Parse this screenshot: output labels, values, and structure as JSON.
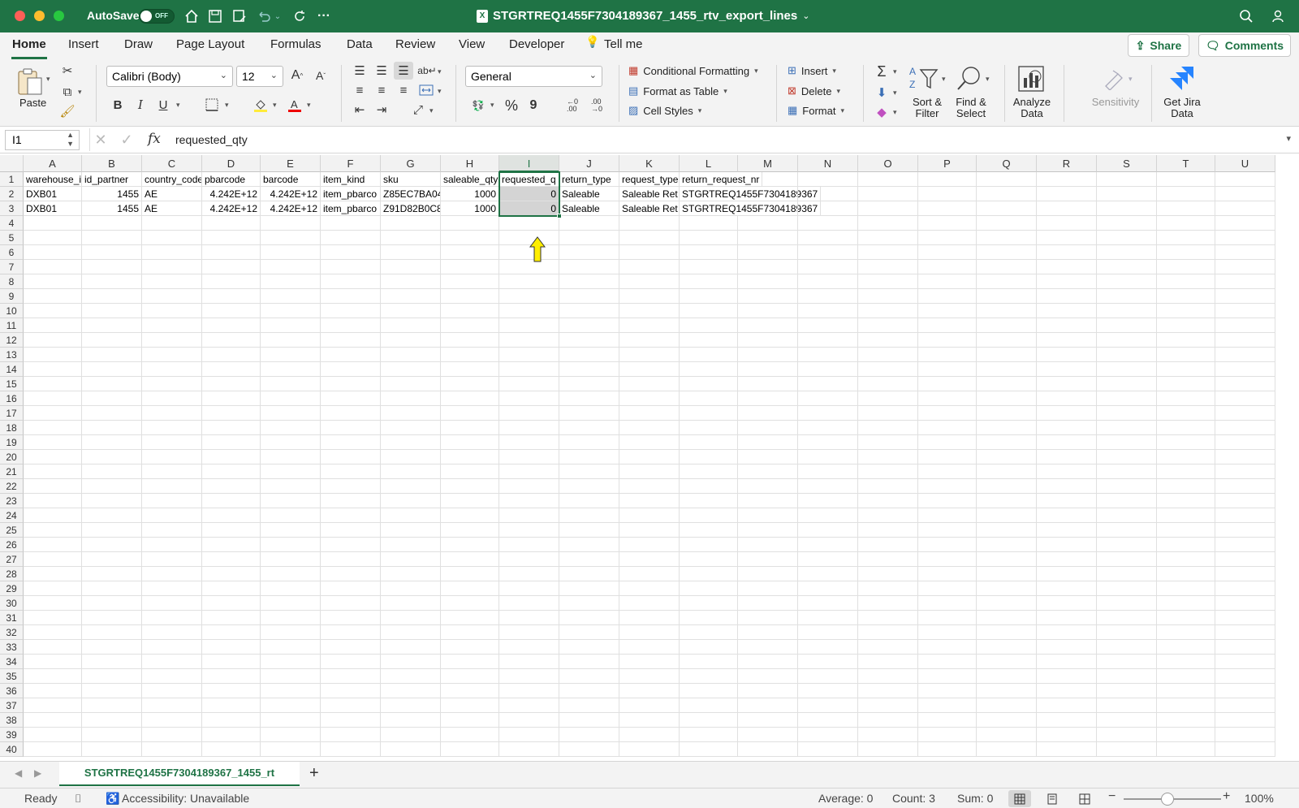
{
  "window": {
    "autosave_label": "AutoSave",
    "autosave_state": "OFF",
    "title": "STGRTREQ1455F7304189367_1455_rtv_export_lines"
  },
  "tabs": [
    "Home",
    "Insert",
    "Draw",
    "Page Layout",
    "Formulas",
    "Data",
    "Review",
    "View",
    "Developer",
    "Tell me"
  ],
  "share_label": "Share",
  "comments_label": "Comments",
  "ribbon": {
    "paste": "Paste",
    "font_name": "Calibri (Body)",
    "font_size": "12",
    "bold": "B",
    "italic": "I",
    "underline": "U",
    "number_format": "General",
    "percent": "%",
    "comma": "9",
    "conditional_formatting": "Conditional Formatting",
    "format_as_table": "Format as Table",
    "cell_styles": "Cell Styles",
    "insert": "Insert",
    "delete": "Delete",
    "format": "Format",
    "sort_filter_1": "Sort &",
    "sort_filter_2": "Filter",
    "find_select_1": "Find &",
    "find_select_2": "Select",
    "analyze_1": "Analyze",
    "analyze_2": "Data",
    "sensitivity": "Sensitivity",
    "jira_1": "Get Jira",
    "jira_2": "Data",
    "accent": "#1f7345"
  },
  "formula_bar": {
    "name_box": "I1",
    "fx": "fx",
    "content": "requested_qty"
  },
  "sheet": {
    "columns": [
      "A",
      "B",
      "C",
      "D",
      "E",
      "F",
      "G",
      "H",
      "I",
      "J",
      "K",
      "L",
      "M",
      "N",
      "O",
      "P",
      "Q",
      "R",
      "S",
      "T",
      "U"
    ],
    "row_numbers": [
      "1",
      "2",
      "3",
      "4",
      "5",
      "6",
      "7",
      "8",
      "9",
      "10",
      "11",
      "12",
      "13",
      "14",
      "15",
      "16",
      "17",
      "18",
      "19",
      "20",
      "21",
      "22",
      "23",
      "24",
      "25",
      "26",
      "27",
      "28",
      "29",
      "30",
      "31",
      "32",
      "33",
      "34",
      "35",
      "36",
      "37",
      "38",
      "39",
      "40"
    ],
    "rows": [
      [
        "warehouse_i",
        "id_partner",
        "country_code",
        "pbarcode",
        "barcode",
        "item_kind",
        "sku",
        "saleable_qty",
        "requested_q",
        "return_type",
        "request_type",
        "return_request_nr"
      ],
      [
        "DXB01",
        "1455",
        "AE",
        "4.242E+12",
        "4.242E+12",
        "item_pbarco",
        "Z85EC7BA04",
        "1000",
        "0",
        "Saleable",
        "Saleable Ret",
        "STGRTREQ1455F7304189367"
      ],
      [
        "DXB01",
        "1455",
        "AE",
        "4.242E+12",
        "4.242E+12",
        "item_pbarco",
        "Z91D82B0C8",
        "1000",
        "0",
        "Saleable",
        "Saleable Ret",
        "STGRTREQ1455F7304189367"
      ]
    ],
    "sheet_tab": "STGRTREQ1455F7304189367_1455_rt",
    "add_sheet": "+"
  },
  "status": {
    "ready": "Ready",
    "accessibility": "Accessibility: Unavailable",
    "average": "Average: 0",
    "count": "Count: 3",
    "sum": "Sum: 0",
    "zoom": "100%",
    "zoom_minus": "−",
    "zoom_plus": "+"
  }
}
